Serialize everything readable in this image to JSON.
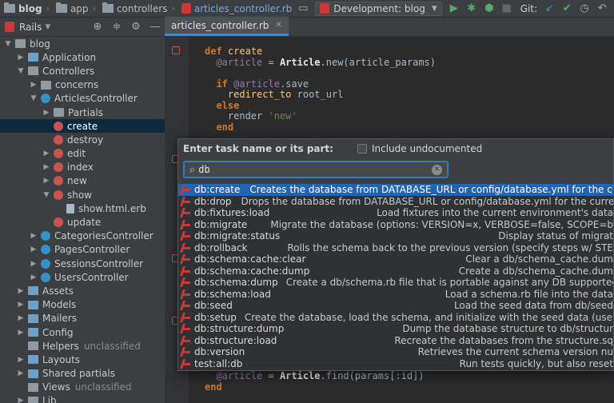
{
  "breadcrumb": [
    {
      "label": "blog",
      "icon": "folder-icon",
      "style": "bold"
    },
    {
      "label": "app",
      "icon": "folder-icon",
      "style": "normal"
    },
    {
      "label": "controllers",
      "icon": "folder-icon",
      "style": "normal"
    },
    {
      "label": "articles_controller.rb",
      "icon": "ruby-file-icon",
      "style": "link"
    }
  ],
  "toolbar": {
    "run_config": "Development: blog",
    "git_label": "Git:"
  },
  "project_panel": {
    "title": "Rails",
    "tree": [
      {
        "label": "blog",
        "depth": 0,
        "arrow": "down",
        "icon": "folder",
        "muted": ""
      },
      {
        "label": "Application",
        "depth": 1,
        "arrow": "right",
        "icon": "folder-blue",
        "muted": ""
      },
      {
        "label": "Controllers",
        "depth": 1,
        "arrow": "down",
        "icon": "folder",
        "muted": ""
      },
      {
        "label": "concerns",
        "depth": 2,
        "arrow": "right",
        "icon": "folder",
        "muted": ""
      },
      {
        "label": "ArticlesController",
        "depth": 2,
        "arrow": "down",
        "icon": "controller",
        "muted": ""
      },
      {
        "label": "Partials",
        "depth": 3,
        "arrow": "right",
        "icon": "folder",
        "muted": ""
      },
      {
        "label": "create",
        "depth": 3,
        "arrow": "",
        "icon": "action",
        "muted": "",
        "selected": true
      },
      {
        "label": "destroy",
        "depth": 3,
        "arrow": "",
        "icon": "action",
        "muted": ""
      },
      {
        "label": "edit",
        "depth": 3,
        "arrow": "right",
        "icon": "action",
        "muted": ""
      },
      {
        "label": "index",
        "depth": 3,
        "arrow": "right",
        "icon": "action",
        "muted": ""
      },
      {
        "label": "new",
        "depth": 3,
        "arrow": "right",
        "icon": "action",
        "muted": ""
      },
      {
        "label": "show",
        "depth": 3,
        "arrow": "down",
        "icon": "action",
        "muted": ""
      },
      {
        "label": "show.html.erb",
        "depth": 4,
        "arrow": "",
        "icon": "file",
        "muted": ""
      },
      {
        "label": "update",
        "depth": 3,
        "arrow": "",
        "icon": "action",
        "muted": ""
      },
      {
        "label": "CategoriesController",
        "depth": 2,
        "arrow": "right",
        "icon": "controller",
        "muted": ""
      },
      {
        "label": "PagesController",
        "depth": 2,
        "arrow": "right",
        "icon": "controller",
        "muted": ""
      },
      {
        "label": "SessionsController",
        "depth": 2,
        "arrow": "right",
        "icon": "controller",
        "muted": ""
      },
      {
        "label": "UsersController",
        "depth": 2,
        "arrow": "right",
        "icon": "controller",
        "muted": ""
      },
      {
        "label": "Assets",
        "depth": 1,
        "arrow": "right",
        "icon": "folder-blue",
        "muted": ""
      },
      {
        "label": "Models",
        "depth": 1,
        "arrow": "right",
        "icon": "folder-blue",
        "muted": ""
      },
      {
        "label": "Mailers",
        "depth": 1,
        "arrow": "right",
        "icon": "folder-blue",
        "muted": ""
      },
      {
        "label": "Config",
        "depth": 1,
        "arrow": "right",
        "icon": "folder-blue",
        "muted": ""
      },
      {
        "label": "Helpers",
        "depth": 1,
        "arrow": "",
        "icon": "folder",
        "muted": "unclassified"
      },
      {
        "label": "Layouts",
        "depth": 1,
        "arrow": "right",
        "icon": "folder-blue",
        "muted": ""
      },
      {
        "label": "Shared partials",
        "depth": 1,
        "arrow": "right",
        "icon": "folder-blue",
        "muted": ""
      },
      {
        "label": "Views",
        "depth": 1,
        "arrow": "",
        "icon": "folder",
        "muted": "unclassified"
      },
      {
        "label": "Lib",
        "depth": 1,
        "arrow": "right",
        "icon": "folder",
        "muted": ""
      }
    ]
  },
  "editor": {
    "tab_label": "articles_controller.rb",
    "code_top": [
      "def create",
      "  @article = Article.new(article_params)",
      "",
      "  if @article.save",
      "    redirect_to root_url",
      "  else",
      "    render 'new'",
      "  end"
    ],
    "code_bottom": [
      "  @article = Article.find(params[:id])",
      "end"
    ]
  },
  "task_popup": {
    "title": "Enter task name or its part:",
    "checkbox_label": "Include undocumented",
    "search_value": "db",
    "tasks": [
      {
        "name": "db:create",
        "desc": "Creates the database from DATABASE_URL or config/database.yml for the current",
        "selected": true,
        "align": "left"
      },
      {
        "name": "db:drop",
        "desc": "Drops the database from DATABASE_URL or config/database.yml for the current R",
        "align": "left"
      },
      {
        "name": "db:fixtures:load",
        "desc": "Load fixtures into the current environment's data",
        "align": "right"
      },
      {
        "name": "db:migrate",
        "desc": "Migrate the database (options: VERSION=x, VERBOSE=false, SCOPE=b",
        "align": "right"
      },
      {
        "name": "db:migrate:status",
        "desc": "Display status of migrat",
        "align": "right"
      },
      {
        "name": "db:rollback",
        "desc": "Rolls the schema back to the previous version (specify steps w/ STE",
        "align": "right"
      },
      {
        "name": "db:schema:cache:clear",
        "desc": "Clear a db/schema_cache.dum",
        "align": "right"
      },
      {
        "name": "db:schema:cache:dump",
        "desc": "Create a db/schema_cache.dum",
        "align": "right"
      },
      {
        "name": "db:schema:dump",
        "desc": "Create a db/schema.rb file that is portable against any DB supported b",
        "align": "right"
      },
      {
        "name": "db:schema:load",
        "desc": "Load a schema.rb file into the data",
        "align": "right"
      },
      {
        "name": "db:seed",
        "desc": "Load the seed data from db/seed",
        "align": "right"
      },
      {
        "name": "db:setup",
        "desc": "Create the database, load the schema, and initialize with the seed data (use c",
        "align": "right"
      },
      {
        "name": "db:structure:dump",
        "desc": "Dump the database structure to db/structur",
        "align": "right"
      },
      {
        "name": "db:structure:load",
        "desc": "Recreate the databases from the structure.sq",
        "align": "right"
      },
      {
        "name": "db:version",
        "desc": "Retrieves the current schema version nu",
        "align": "right"
      },
      {
        "name": "test:all:db",
        "desc": "Run tests quickly, but also reset",
        "align": "right"
      }
    ]
  }
}
